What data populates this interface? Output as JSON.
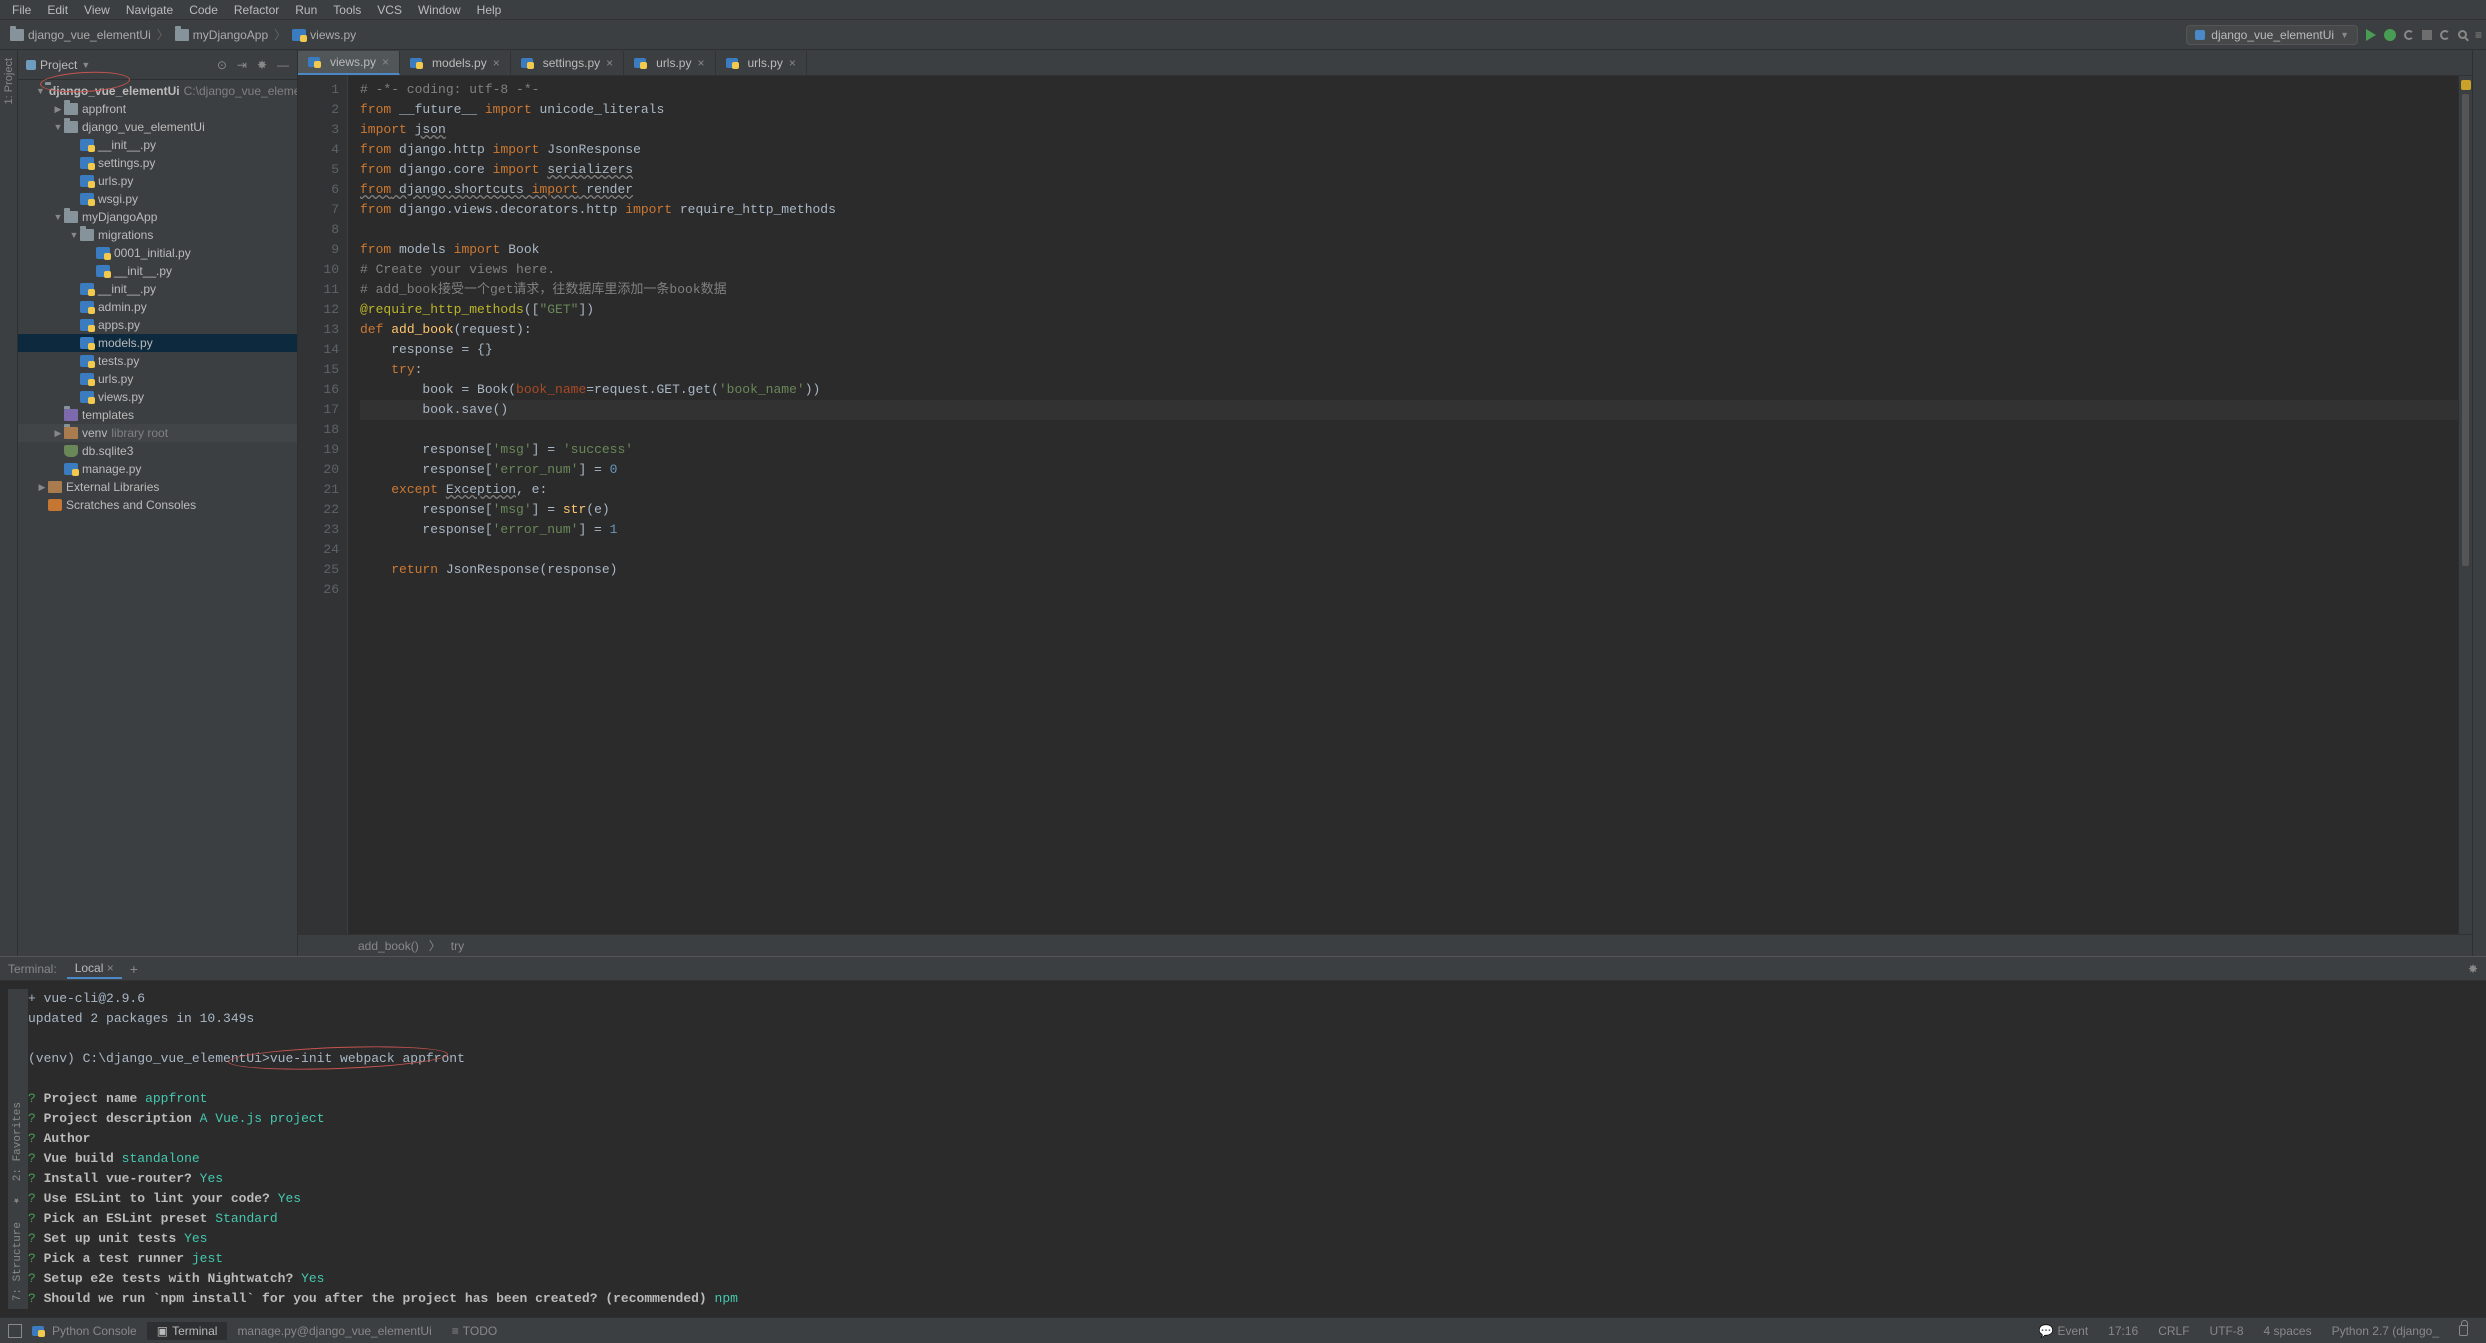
{
  "menu": {
    "file": "File",
    "edit": "Edit",
    "view": "View",
    "navigate": "Navigate",
    "code": "Code",
    "refactor": "Refactor",
    "run": "Run",
    "tools": "Tools",
    "vcs": "VCS",
    "window": "Window",
    "help": "Help"
  },
  "nav": {
    "crumb1": "django_vue_elementUi",
    "crumb2": "myDjangoApp",
    "crumb3": "views.py",
    "run_config": "django_vue_elementUi"
  },
  "project_panel": {
    "title": "Project",
    "root": "django_vue_elementUi",
    "root_path": "C:\\django_vue_elementUi",
    "appfront": "appfront",
    "pkg": "django_vue_elementUi",
    "init": "__init__.py",
    "settings": "settings.py",
    "urls": "urls.py",
    "wsgi": "wsgi.py",
    "app": "myDjangoApp",
    "migrations": "migrations",
    "m0001": "0001_initial.py",
    "minit": "__init__.py",
    "ainit": "__init__.py",
    "admin": "admin.py",
    "apps": "apps.py",
    "models": "models.py",
    "tests": "tests.py",
    "aurls": "urls.py",
    "views": "views.py",
    "templates": "templates",
    "venv": "venv",
    "venv_hint": "library root",
    "db": "db.sqlite3",
    "manage": "manage.py",
    "ext": "External Libraries",
    "scratch": "Scratches and Consoles"
  },
  "tabs": {
    "views": "views.py",
    "models": "models.py",
    "settings": "settings.py",
    "urls1": "urls.py",
    "urls2": "urls.py"
  },
  "code_crumb": {
    "fn": "add_book()",
    "scope": "try"
  },
  "code_lines": [
    "# -*- coding: utf-8 -*-",
    "from __future__ import unicode_literals",
    "import json",
    "from django.http import JsonResponse",
    "from django.core import serializers",
    "from django.shortcuts import render",
    "from django.views.decorators.http import require_http_methods",
    "",
    "from models import Book",
    "# Create your views here.",
    "# add_book接受一个get请求，往数据库里添加一条book数据",
    "@require_http_methods([\"GET\"])",
    "def add_book(request):",
    "    response = {}",
    "    try:",
    "        book = Book(book_name=request.GET.get('book_name'))",
    "        book.save()",
    "        response['msg'] = 'success'",
    "        response['error_num'] = 0",
    "    except Exception, e:",
    "        response['msg'] = str(e)",
    "        response['error_num'] = 1",
    "",
    "    return JsonResponse(response)",
    "",
    ""
  ],
  "terminal": {
    "header_label": "Terminal:",
    "tab": "Local",
    "line_vuecli": "+ vue-cli@2.9.6",
    "line_updated": "updated 2 packages in 10.349s",
    "prompt": "(venv) C:\\django_vue_elementUi>",
    "cmd": "vue-init webpack appfront",
    "q_project_name": "Project name",
    "a_project_name": "appfront",
    "q_desc": "Project description",
    "a_desc": "A Vue.js project",
    "q_author": "Author",
    "q_build": "Vue build",
    "a_build": "standalone",
    "q_router": "Install vue-router?",
    "a_router": "Yes",
    "q_eslint": "Use ESLint to lint your code?",
    "a_eslint": "Yes",
    "q_preset": "Pick an ESLint preset",
    "a_preset": "Standard",
    "q_unit": "Set up unit tests",
    "a_unit": "Yes",
    "q_runner": "Pick a test runner",
    "a_runner": "jest",
    "q_e2e": "Setup e2e tests with Nightwatch?",
    "a_e2e": "Yes",
    "q_npm": "Should we run `npm install` for you after the project has been created? (recommended)",
    "a_npm": "npm"
  },
  "status": {
    "pyconsole": "Python Console",
    "terminal": "Terminal",
    "django": "manage.py@django_vue_elementUi",
    "todo": "TODO",
    "event": "Event",
    "pos": "17:16",
    "eol": "CRLF",
    "enc": "UTF-8",
    "indent": "4 spaces",
    "python": "Python 2.7 (django_"
  },
  "left_strip": {
    "project": "1: Project",
    "fav": "2: Favorites",
    "struct": "7: Structure"
  }
}
